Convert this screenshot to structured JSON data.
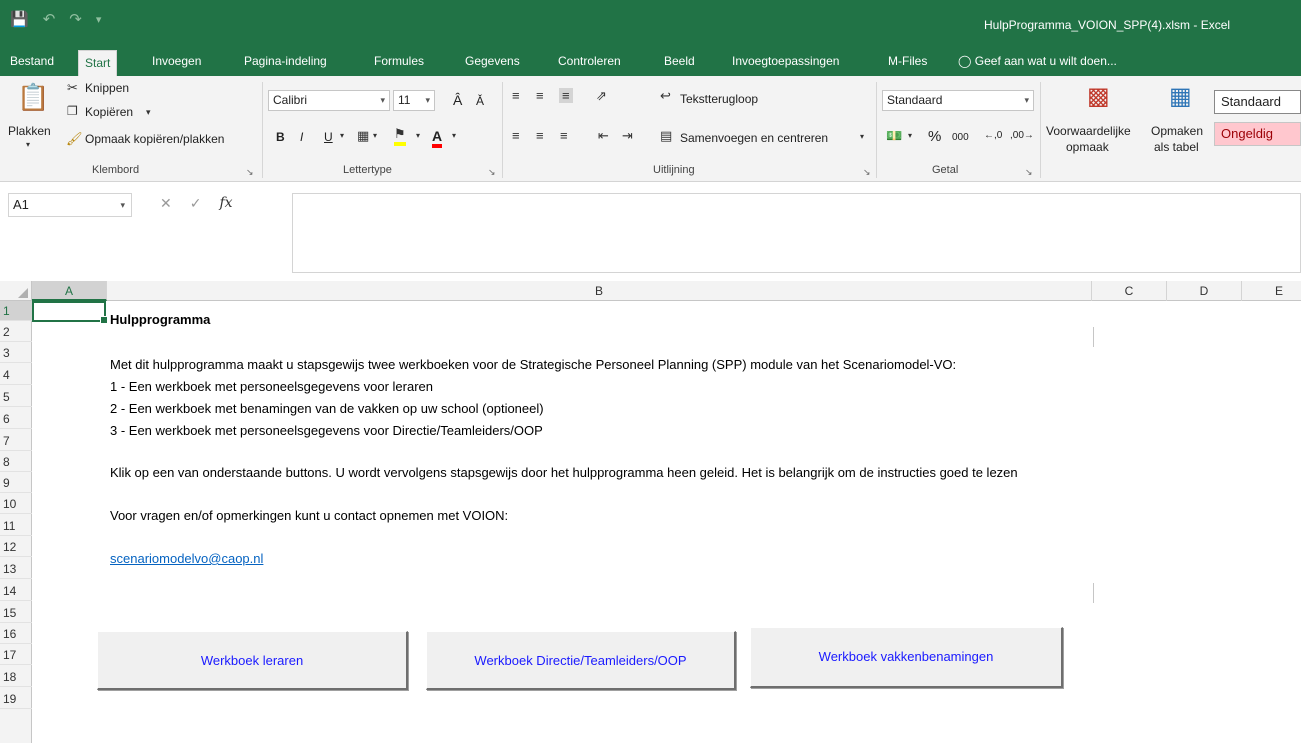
{
  "window": {
    "title": "HulpProgramma_VOION_SPP(4).xlsm - Excel"
  },
  "ribbon_tabs": [
    "Bestand",
    "Start",
    "Invoegen",
    "Pagina-indeling",
    "Formules",
    "Gegevens",
    "Controleren",
    "Beeld",
    "Invoegtoepassingen",
    "M-Files"
  ],
  "tell_me": "Geef aan wat u wilt doen...",
  "clipboard": {
    "paste": "Plakken",
    "cut": "Knippen",
    "copy": "Kopiëren",
    "format_painter": "Opmaak kopiëren/plakken",
    "label": "Klembord"
  },
  "font": {
    "name": "Calibri",
    "size": "11",
    "label": "Lettertype",
    "bold": "B",
    "italic": "I",
    "underline": "U"
  },
  "alignment": {
    "wrap": "Tekstterugloop",
    "merge": "Samenvoegen en centreren",
    "label": "Uitlijning"
  },
  "number": {
    "format": "Standaard",
    "percent": "%",
    "thousands": "000",
    "label": "Getal"
  },
  "styles": {
    "conditional": "Voorwaardelijke",
    "conditional2": "opmaak",
    "table": "Opmaken",
    "table2": "als tabel",
    "style_normal": "Standaard",
    "style_bad": "Ongeldig"
  },
  "formula_bar": {
    "name_box": "A1",
    "fx": "fx"
  },
  "columns": [
    "A",
    "B",
    "C",
    "D",
    "E"
  ],
  "rows": [
    "1",
    "2",
    "3",
    "4",
    "5",
    "6",
    "7",
    "8",
    "9",
    "10",
    "11",
    "12",
    "13",
    "14",
    "15",
    "16",
    "17",
    "18",
    "19"
  ],
  "sheet": {
    "r1": "Hulpprogramma",
    "r3": "Met dit  hulpprogramma maakt u stapsgewijs  twee werkboeken voor de Strategische Personeel Planning (SPP) module van het Scenariomodel-VO:",
    "r4": "1 - Een werkboek met personeelsgegevens voor leraren",
    "r5": "2 - Een werkboek met benamingen van de vakken op uw school (optioneel)",
    "r6": "3 - Een werkboek met personeelsgegevens voor Directie/Teamleiders/OOP",
    "r8": "Klik op een van onderstaande buttons. U wordt vervolgens stapsgewijs door het hulpprogramma heen geleid.  Het is belangrijk om de instructies goed te lezen",
    "r10": "Voor vragen en/of opmerkingen kunt u contact opnemen met VOION:",
    "r12": "scenariomodelvo@caop.nl"
  },
  "buttons": {
    "leraren": "Werkboek leraren",
    "directie": "Werkboek Directie/Teamleiders/OOP",
    "vakken": "Werkboek vakkenbenamingen"
  }
}
